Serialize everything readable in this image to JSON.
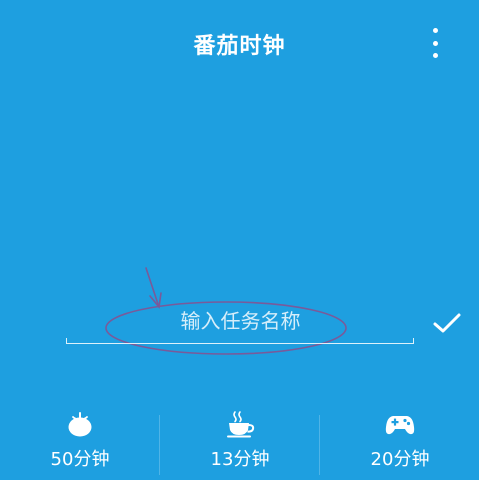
{
  "header": {
    "title": "番茄时钟",
    "menu_icon": "more-vert-icon"
  },
  "task": {
    "placeholder": "输入任务名称",
    "value": "",
    "confirm_icon": "check-icon"
  },
  "presets": [
    {
      "icon": "tomato-icon",
      "label": "50分钟"
    },
    {
      "icon": "coffee-cup-icon",
      "label": "13分钟"
    },
    {
      "icon": "gamepad-icon",
      "label": "20分钟"
    }
  ],
  "colors": {
    "background": "#1e9fe0",
    "foreground": "#ffffff",
    "annotation": "#7a5a9a"
  }
}
